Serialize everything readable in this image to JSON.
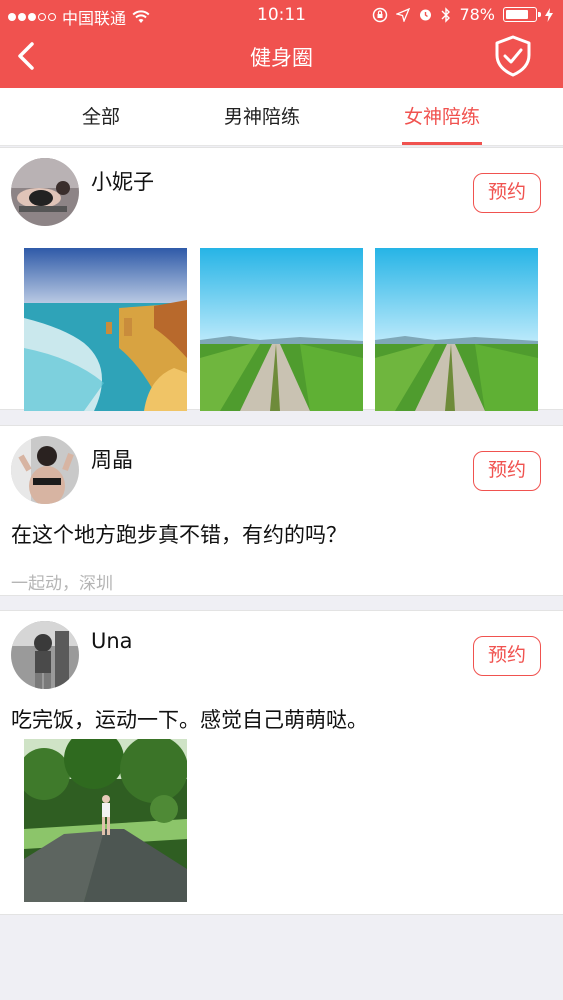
{
  "status_bar": {
    "carrier": "中国联通",
    "time": "10:11",
    "battery": "78%"
  },
  "nav": {
    "title": "健身圈"
  },
  "tabs": [
    {
      "label": "全部",
      "active": false
    },
    {
      "label": "男神陪练",
      "active": false
    },
    {
      "label": "女神陪练",
      "active": true
    }
  ],
  "posts": [
    {
      "name": "小妮子",
      "book_label": "预约"
    },
    {
      "name": "周晶",
      "book_label": "预约",
      "text": "在这个地方跑步真不错，有约的吗？",
      "location": "一起动，深圳"
    },
    {
      "name": "Una",
      "book_label": "预约",
      "text": "吃完饭，运动一下。感觉自己萌萌哒。"
    }
  ],
  "colors": {
    "accent": "#f0524f",
    "background": "#efeff4",
    "muted_text": "#b5b5b5"
  }
}
